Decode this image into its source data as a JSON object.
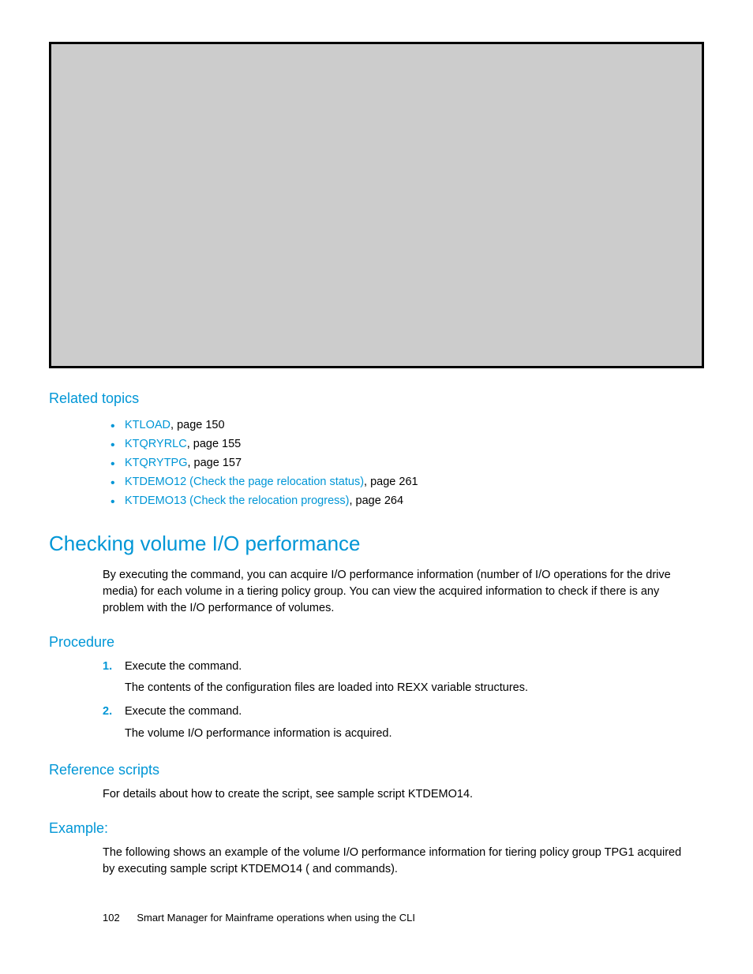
{
  "related": {
    "heading": "Related topics",
    "items": [
      {
        "link": "KTLOAD",
        "rest": ", page 150"
      },
      {
        "link": "KTQRYRLC",
        "rest": ", page 155"
      },
      {
        "link": "KTQRYTPG",
        "rest": ", page 157"
      },
      {
        "link": "KTDEMO12 (Check the page relocation status)",
        "rest": ", page 261"
      },
      {
        "link": "KTDEMO13 (Check the relocation progress)",
        "rest": ", page 264"
      }
    ]
  },
  "main": {
    "heading": "Checking volume I/O performance",
    "body": "By executing the                   command, you can acquire I/O performance information (number of I/O operations for the drive media) for each volume in a tiering policy group. You can view the acquired information to check if there is any problem with the I/O performance of volumes."
  },
  "procedure": {
    "heading": "Procedure",
    "steps": [
      {
        "title": "Execute the                command.",
        "desc": "The contents of the configuration files are loaded into REXX variable structures."
      },
      {
        "title": "Execute the                   command.",
        "desc": "The volume I/O performance information is acquired."
      }
    ]
  },
  "reference": {
    "heading": "Reference scripts",
    "body": "For details about how to create the script, see sample script KTDEMO14."
  },
  "example": {
    "heading": "Example:",
    "body": "The following shows an example of the volume I/O performance information for tiering policy group TPG1 acquired by executing sample script KTDEMO14 (               and                   commands)."
  },
  "footer": {
    "page": "102",
    "title": "Smart Manager for Mainframe operations when using the CLI"
  }
}
